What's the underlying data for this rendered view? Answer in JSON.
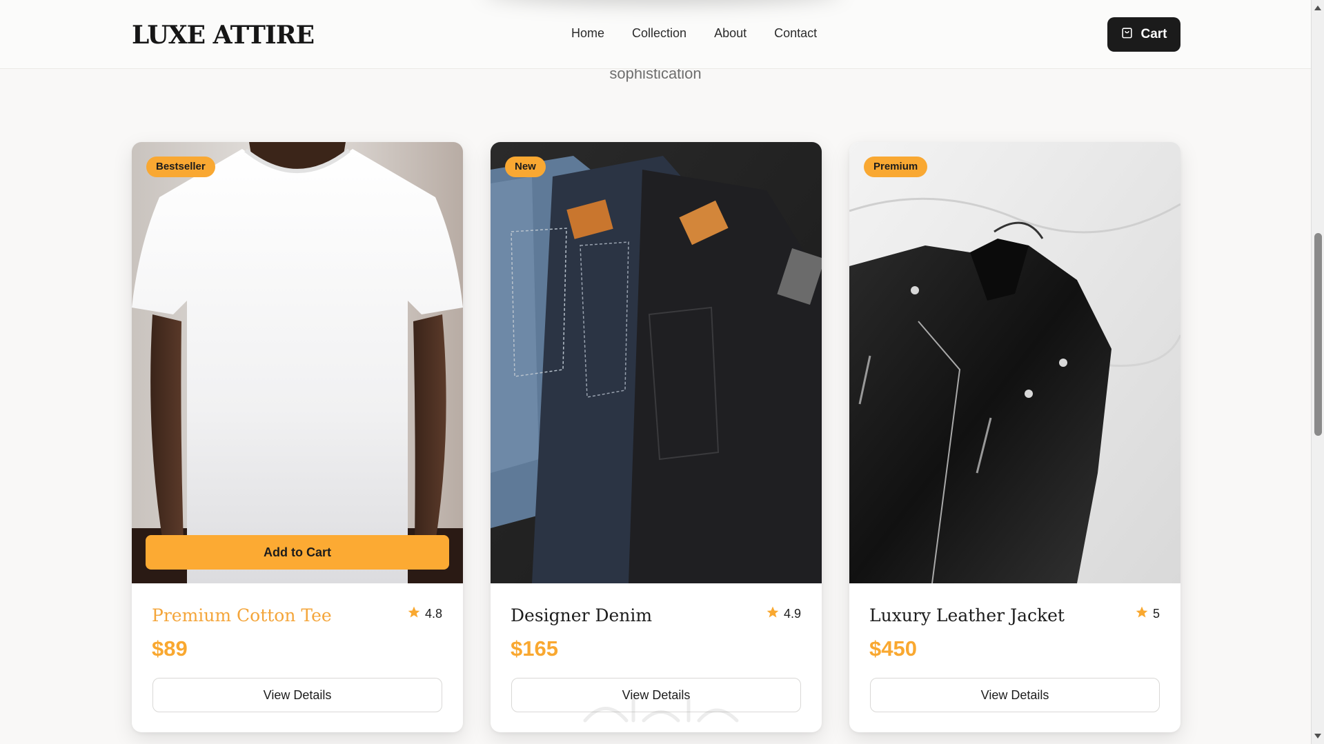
{
  "header": {
    "brand": "LUXE ATTIRE",
    "nav": [
      "Home",
      "Collection",
      "About",
      "Contact"
    ],
    "cart_label": "Cart"
  },
  "hero": {
    "subtitle_fragment": "sophistication"
  },
  "products": [
    {
      "badge": "Bestseller",
      "name": "Premium Cotton Tee",
      "rating": "4.8",
      "price": "$89",
      "add_to_cart": "Add to Cart",
      "details": "View Details",
      "image": "white-tshirt-model"
    },
    {
      "badge": "New",
      "name": "Designer Denim",
      "rating": "4.9",
      "price": "$165",
      "details": "View Details",
      "image": "folded-jeans"
    },
    {
      "badge": "Premium",
      "name": "Luxury Leather Jacket",
      "rating": "5",
      "price": "$450",
      "details": "View Details",
      "image": "black-leather-jacket"
    }
  ],
  "colors": {
    "accent": "#fcaa33",
    "primary_button": "#1b1b1b",
    "background": "#f9f8f7"
  },
  "icons": [
    "shopping-bag-icon",
    "star-icon"
  ]
}
